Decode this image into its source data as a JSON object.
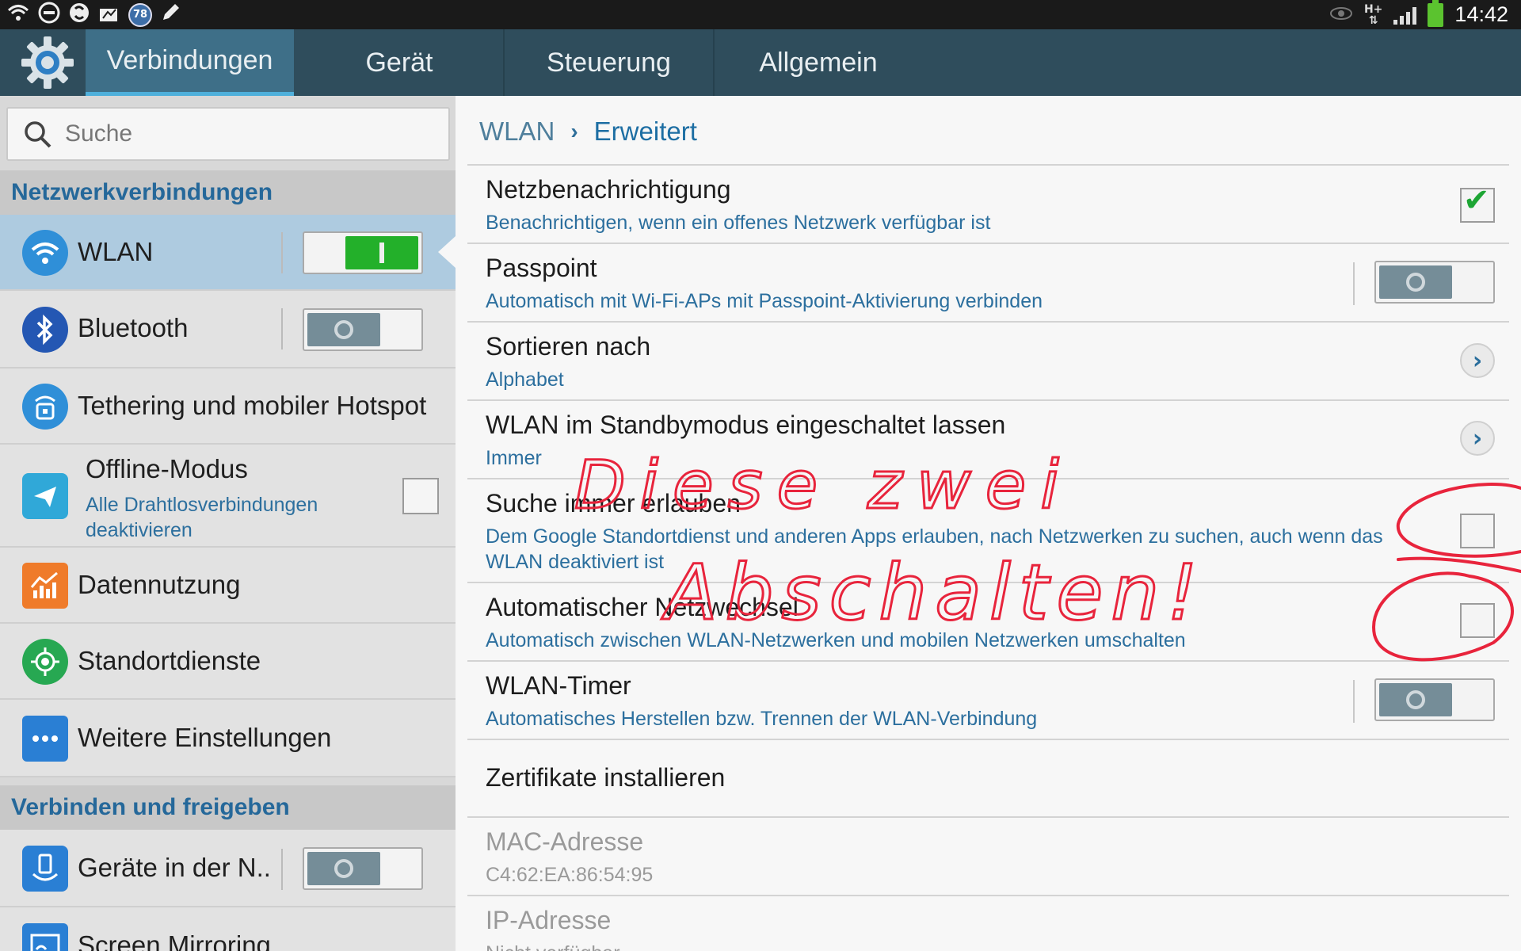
{
  "status_bar": {
    "battery_badge": "78",
    "network": "H+",
    "time": "14:42",
    "icons": [
      "wifi-signal-icon",
      "minus-circle-icon",
      "sync-icon",
      "data-icon",
      "badge-icon",
      "pen-icon",
      "eye-icon",
      "network-arrows-icon",
      "signal-icon",
      "battery-icon"
    ]
  },
  "tabs": [
    {
      "label": "Verbindungen",
      "active": true
    },
    {
      "label": "Gerät",
      "active": false
    },
    {
      "label": "Steuerung",
      "active": false
    },
    {
      "label": "Allgemein",
      "active": false
    }
  ],
  "search": {
    "placeholder": "Suche"
  },
  "sidebar": {
    "section1": "Netzwerkverbindungen",
    "section2": "Verbinden und freigeben",
    "items": [
      {
        "label": "WLAN",
        "icon": "wifi-icon",
        "switch": "on",
        "selected": true
      },
      {
        "label": "Bluetooth",
        "icon": "bluetooth-icon",
        "switch": "off"
      },
      {
        "label": "Tethering und mobiler Hotspot",
        "icon": "hotspot-icon"
      },
      {
        "label": "Offline-Modus",
        "sub": "Alle Drahtlosverbindungen deaktivieren",
        "icon": "airplane-icon",
        "checked": false
      },
      {
        "label": "Datennutzung",
        "icon": "data-usage-icon"
      },
      {
        "label": "Standortdienste",
        "icon": "location-icon"
      },
      {
        "label": "Weitere Einstellungen",
        "icon": "more-icon"
      },
      {
        "label": "Geräte in der N..",
        "icon": "nearby-devices-icon",
        "switch": "off"
      },
      {
        "label": "Screen Mirroring",
        "icon": "screen-mirroring-icon"
      }
    ]
  },
  "main": {
    "breadcrumb": {
      "root": "WLAN",
      "current": "Erweitert"
    },
    "rows": [
      {
        "title": "Netzbenachrichtigung",
        "sub": "Benachrichtigen, wenn ein offenes Netzwerk verfügbar ist",
        "control": "checkbox",
        "checked": true
      },
      {
        "title": "Passpoint",
        "sub": "Automatisch mit Wi-Fi-APs mit Passpoint-Aktivierung verbinden",
        "control": "switch",
        "state": "off"
      },
      {
        "title": "Sortieren nach",
        "sub": "Alphabet",
        "control": "chevron"
      },
      {
        "title": "WLAN im Standbymodus eingeschaltet lassen",
        "sub": "Immer",
        "control": "chevron"
      },
      {
        "title": "Suche immer erlauben",
        "sub": "Dem Google Standortdienst und anderen Apps erlauben, nach Netzwerken zu suchen, auch wenn das",
        "sub2": "WLAN deaktiviert ist",
        "control": "checkbox",
        "checked": false
      },
      {
        "title": "Automatischer Netzwechsel",
        "sub": "Automatisch zwischen WLAN-Netzwerken und mobilen Netzwerken umschalten",
        "control": "checkbox",
        "checked": false
      },
      {
        "title": "WLAN-Timer",
        "sub": "Automatisches Herstellen bzw. Trennen der WLAN-Verbindung",
        "control": "switch",
        "state": "off"
      },
      {
        "title": "Zertifikate installieren"
      },
      {
        "title": "MAC-Adresse",
        "sub": "C4:62:EA:86:54:95",
        "disabled": true
      },
      {
        "title": "IP-Adresse",
        "sub": "Nicht verfügbar",
        "disabled": true
      }
    ]
  },
  "annotation": {
    "line1": "Diese zwei",
    "line2": "Abschalten!",
    "color": "#e8243c"
  }
}
